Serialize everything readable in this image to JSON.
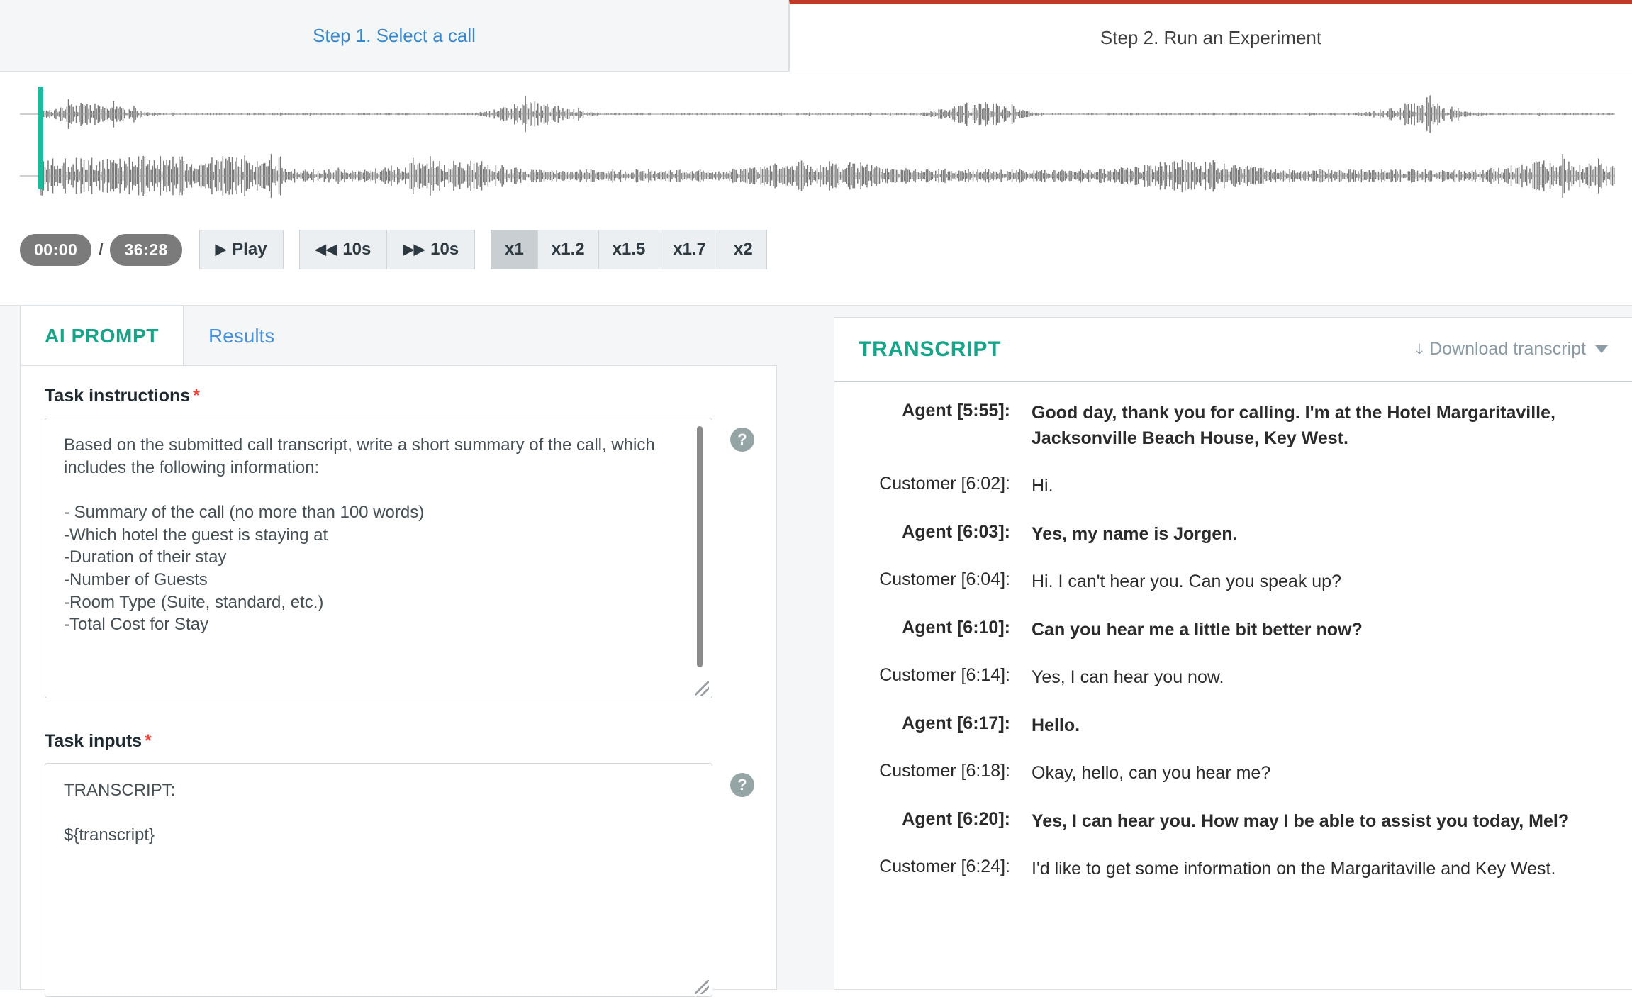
{
  "steps": [
    {
      "label": "Step 1. Select a call",
      "active": false
    },
    {
      "label": "Step 2. Run an Experiment",
      "active": true
    }
  ],
  "player": {
    "current_time": "00:00",
    "total_time": "36:28",
    "separator": "/",
    "play_label": "Play",
    "play_icon": "▶",
    "rewind_label": "10s",
    "rewind_icon": "◀◀",
    "forward_label": "10s",
    "forward_icon": "▶▶",
    "speeds": [
      "x1",
      "x1.2",
      "x1.5",
      "x1.7",
      "x2"
    ],
    "active_speed": "x1",
    "playhead_color": "#1abc9c",
    "waveform_color": "#7a7a7a"
  },
  "prompt": {
    "tabs": [
      {
        "label": "AI PROMPT",
        "active": true
      },
      {
        "label": "Results",
        "active": false
      }
    ],
    "instructions": {
      "label": "Task instructions",
      "required_mark": "*",
      "value": "Based on the submitted call transcript, write a short summary of the call, which includes the following information:\n\n- Summary of the call (no more than 100 words)\n-Which hotel the guest is staying at\n-Duration of their stay\n-Number of Guests\n-Room Type (Suite, standard, etc.)\n-Total Cost for Stay",
      "help_icon": "?"
    },
    "inputs": {
      "label": "Task inputs",
      "required_mark": "*",
      "value": "TRANSCRIPT:\n\n${transcript}",
      "help_icon": "?"
    }
  },
  "transcript": {
    "title": "TRANSCRIPT",
    "download_label": "Download transcript",
    "download_icon": "⤓",
    "rows": [
      {
        "speaker": "Agent [5:55]:",
        "text": "Good day, thank you for calling. I'm at the Hotel Margaritaville, Jacksonville Beach House, Key West.",
        "role": "agent"
      },
      {
        "speaker": "Customer [6:02]:",
        "text": "Hi.",
        "role": "customer"
      },
      {
        "speaker": "Agent [6:03]:",
        "text": "Yes, my name is Jorgen.",
        "role": "agent"
      },
      {
        "speaker": "Customer [6:04]:",
        "text": "Hi. I can't hear you. Can you speak up?",
        "role": "customer"
      },
      {
        "speaker": "Agent [6:10]:",
        "text": "Can you hear me a little bit better now?",
        "role": "agent"
      },
      {
        "speaker": "Customer [6:14]:",
        "text": "Yes, I can hear you now.",
        "role": "customer"
      },
      {
        "speaker": "Agent [6:17]:",
        "text": "Hello.",
        "role": "agent"
      },
      {
        "speaker": "Customer [6:18]:",
        "text": "Okay, hello, can you hear me?",
        "role": "customer"
      },
      {
        "speaker": "Agent [6:20]:",
        "text": "Yes, I can hear you. How may I be able to assist you today, Mel?",
        "role": "agent"
      },
      {
        "speaker": "Customer [6:24]:",
        "text": "I'd like to get some information on the Margaritaville and Key West.",
        "role": "customer"
      }
    ]
  },
  "colors": {
    "accent_teal": "#17a589",
    "link_blue": "#3a87c8",
    "active_tab_red": "#c0392b",
    "required_red": "#e8453c"
  }
}
